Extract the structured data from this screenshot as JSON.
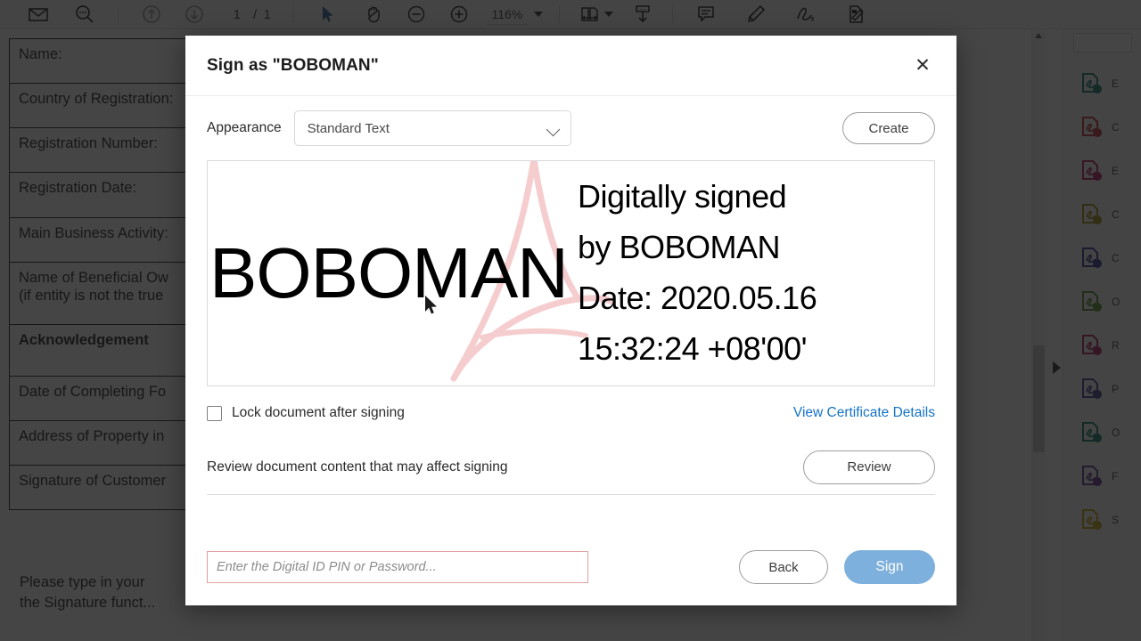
{
  "toolbar": {
    "icons": [
      {
        "name": "email-icon",
        "label": "Email"
      },
      {
        "name": "search-icon",
        "label": "Search"
      },
      {
        "name": "previous-page-icon",
        "label": "Previous Page"
      },
      {
        "name": "next-page-icon",
        "label": "Next Page"
      },
      {
        "name": "select-cursor-icon",
        "label": "Select Tool"
      },
      {
        "name": "hand-tool-icon",
        "label": "Hand Tool"
      },
      {
        "name": "zoom-out-icon",
        "label": "Zoom Out"
      },
      {
        "name": "zoom-in-icon",
        "label": "Zoom In"
      },
      {
        "name": "fit-page-icon",
        "label": "Fit Page"
      },
      {
        "name": "download-icon",
        "label": "Download"
      },
      {
        "name": "comment-icon",
        "label": "Add Comment"
      },
      {
        "name": "highlight-icon",
        "label": "Highlight"
      },
      {
        "name": "draw-signature-icon",
        "label": "Draw"
      },
      {
        "name": "sign-document-icon",
        "label": "Sign Document"
      }
    ],
    "current_page": "1",
    "page_separator": "/",
    "total_pages": "1",
    "zoom_level": "116%"
  },
  "document": {
    "rows": [
      "Name:",
      "Country of Registration:",
      "Registration Number:",
      "Registration Date:",
      "Main Business Activity:",
      "Name of Beneficial Ow\n(if entity is not the true",
      "Acknowledgement",
      "Date of Completing Fo",
      "Address of Property in",
      "Signature of Customer"
    ],
    "bold_row_index": 6,
    "note": "Please type in your\nthe Signature funct..."
  },
  "right_rail": {
    "items": [
      {
        "name": "export-pdf-icon",
        "label": "E",
        "color": "#0a7b6c"
      },
      {
        "name": "create-pdf-icon",
        "label": "C",
        "color": "#c1272d"
      },
      {
        "name": "edit-pdf-icon",
        "label": "E",
        "color": "#b5175b"
      },
      {
        "name": "comment-tool-icon",
        "label": "C",
        "color": "#9e8a08"
      },
      {
        "name": "combine-files-icon",
        "label": "C",
        "color": "#2b2f8f"
      },
      {
        "name": "organize-pages-icon",
        "label": "O",
        "color": "#4f8a1f"
      },
      {
        "name": "redact-icon",
        "label": "R",
        "color": "#b5175b"
      },
      {
        "name": "protect-icon",
        "label": "P",
        "color": "#3b3b8f"
      },
      {
        "name": "optimize-pdf-icon",
        "label": "O",
        "color": "#0a7b6c"
      },
      {
        "name": "fill-and-sign-icon",
        "label": "F",
        "color": "#5a2d91"
      },
      {
        "name": "prepare-form-icon",
        "label": "S",
        "color": "#c8a502"
      }
    ]
  },
  "dialog": {
    "title": "Sign as \"BOBOMAN\"",
    "close_label": "✕",
    "appearance_label": "Appearance",
    "appearance_value": "Standard Text",
    "appearance_options": [
      "Standard Text"
    ],
    "create_label": "Create",
    "signature": {
      "name": "BOBOMAN",
      "details": [
        "Digitally signed",
        "by BOBOMAN",
        "Date: 2020.05.16",
        "15:32:24 +08'00'"
      ],
      "watermark_color": "#f6c9cb"
    },
    "lock_checkbox_label": "Lock document after signing",
    "lock_checked": false,
    "certificate_link": "View Certificate Details",
    "review_text": "Review document content that may affect signing",
    "review_button": "Review",
    "pin_value": "",
    "pin_placeholder": "Enter the Digital ID PIN or Password...",
    "back_label": "Back",
    "sign_label": "Sign",
    "accent_color": "#7eb0dd",
    "link_color": "#1473c6",
    "pin_border_color": "#e0a0a0"
  }
}
